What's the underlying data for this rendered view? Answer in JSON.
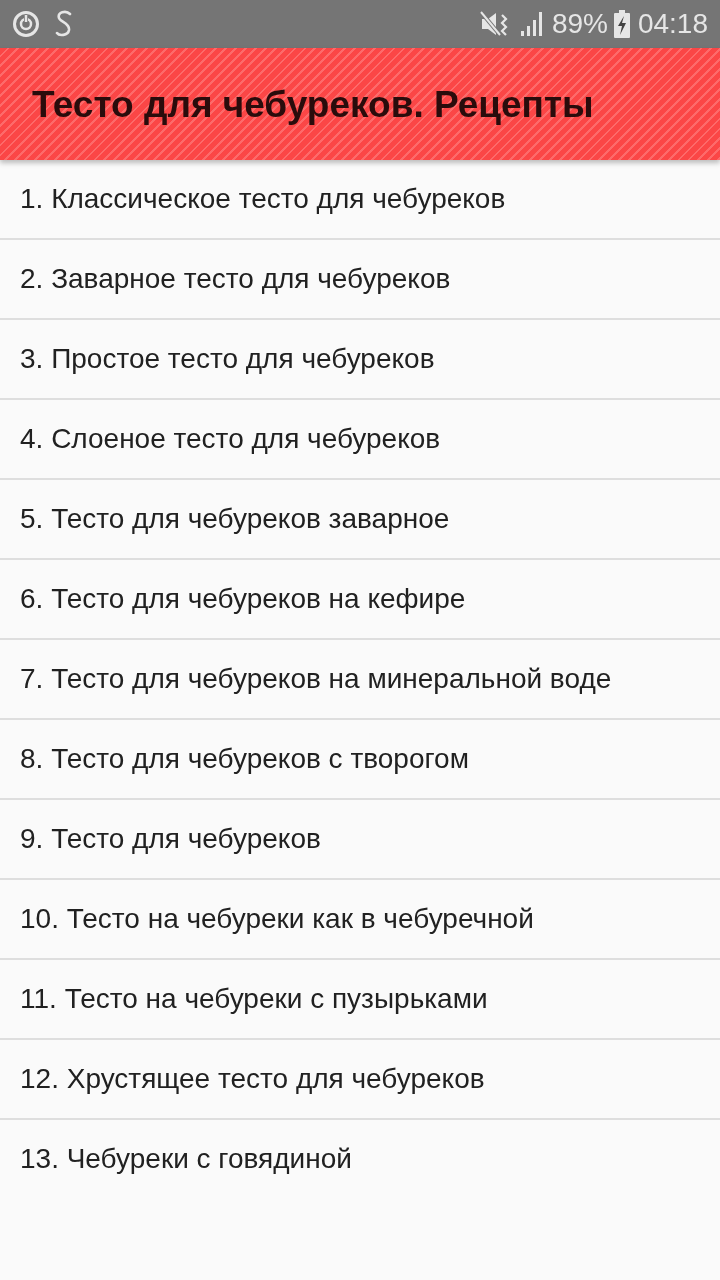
{
  "status_bar": {
    "battery_percent": "89%",
    "time": "04:18"
  },
  "app_bar": {
    "title": "Тесто для чебуреков. Рецепты"
  },
  "recipes": [
    {
      "label": "1. Классическое тесто для чебуреков"
    },
    {
      "label": "2. Заварное тесто для чебуреков"
    },
    {
      "label": "3. Простое тесто для чебуреков"
    },
    {
      "label": "4. Слоеное тесто для чебуреков"
    },
    {
      "label": "5. Тесто для чебуреков заварное"
    },
    {
      "label": "6. Тесто для чебуреков на кефире"
    },
    {
      "label": "7. Тесто для чебуреков на минеральной воде"
    },
    {
      "label": "8. Тесто для чебуреков с творогом"
    },
    {
      "label": "9. Тесто для чебуреков"
    },
    {
      "label": "10. Тесто на чебуреки как в чебуречной"
    },
    {
      "label": "11. Тесто на чебуреки с пузырьками"
    },
    {
      "label": "12. Хрустящее тесто для чебуреков"
    },
    {
      "label": "13. Чебуреки с говядиной"
    }
  ]
}
